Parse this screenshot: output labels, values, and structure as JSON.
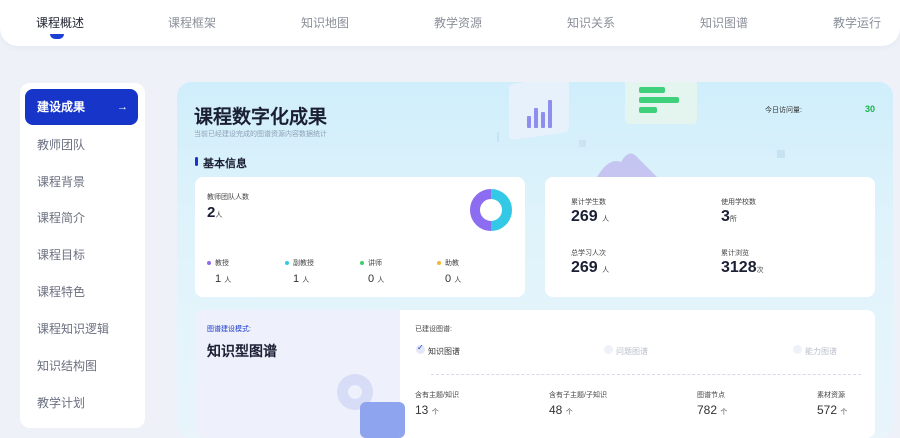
{
  "nav": {
    "tabs": [
      "课程概述",
      "课程框架",
      "知识地图",
      "教学资源",
      "知识关系",
      "知识图谱",
      "教学运行"
    ],
    "active_index": 0
  },
  "sidebar": {
    "items": [
      "建设成果",
      "教师团队",
      "课程背景",
      "课程简介",
      "课程目标",
      "课程特色",
      "课程知识逻辑",
      "知识结构图",
      "教学计划"
    ],
    "active_index": 0,
    "active_arrow": "→"
  },
  "main": {
    "title": "课程数字化成果",
    "subtitle": "当前已经建设完成的图谱资源内容数据统计",
    "visit_label": "今日访问量:",
    "visit_value": "30",
    "section_title": "基本信息"
  },
  "team_card": {
    "label": "教师团队人数",
    "value": "2",
    "unit": "人",
    "roles": [
      {
        "name": "教授",
        "count": "1",
        "unit": "人",
        "color": "#8c6cf0"
      },
      {
        "name": "副教授",
        "count": "1",
        "unit": "人",
        "color": "#33c9e6"
      },
      {
        "name": "讲师",
        "count": "0",
        "unit": "人",
        "color": "#3fce6a"
      },
      {
        "name": "助教",
        "count": "0",
        "unit": "人",
        "color": "#f5b731"
      }
    ],
    "donut": {
      "colors": [
        "#8c6cf0",
        "#33c9e6"
      ],
      "shares": [
        0.5,
        0.5
      ]
    }
  },
  "stats_card": {
    "items": [
      {
        "label": "累计学生数",
        "value": "269",
        "unit": "人"
      },
      {
        "label": "使用学校数",
        "value": "3",
        "unit": "所"
      },
      {
        "label": "总学习人次",
        "value": "269",
        "unit": "人"
      },
      {
        "label": "累计浏览",
        "value": "3128",
        "unit": "次"
      }
    ]
  },
  "graph_card": {
    "mode_label": "图谱建设模式:",
    "mode_value": "知识型图谱",
    "built_label": "已建设图谱:",
    "graph_types": [
      {
        "name": "知识图谱",
        "checked": true
      },
      {
        "name": "问题图谱",
        "checked": false
      },
      {
        "name": "能力图谱",
        "checked": false
      }
    ],
    "check_mark": "✓",
    "metrics": [
      {
        "label": "含有主题/知识",
        "value": "13",
        "unit": "个"
      },
      {
        "label": "含有子主题/子知识",
        "value": "48",
        "unit": "个"
      },
      {
        "label": "图谱节点",
        "value": "782",
        "unit": "个"
      },
      {
        "label": "素材资源",
        "value": "572",
        "unit": "个"
      }
    ]
  },
  "colors": {
    "accent": "#1736c9",
    "visit_green": "#19b34a"
  }
}
